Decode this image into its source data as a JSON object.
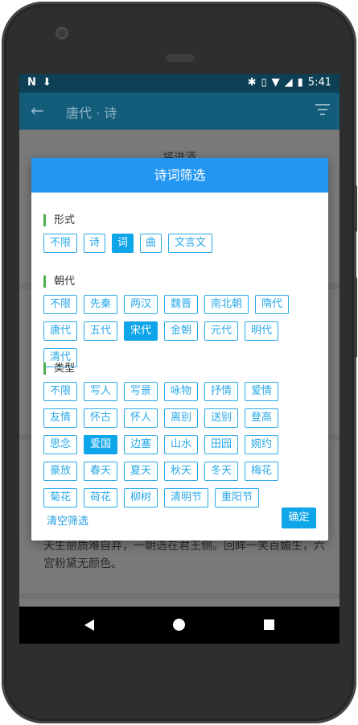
{
  "status": {
    "time": "5:41",
    "left_icons": [
      "N",
      "⬇"
    ],
    "right_icons": [
      "bluetooth-icon",
      "vibrate-icon",
      "wifi-icon",
      "signal-icon",
      "battery-icon"
    ]
  },
  "appbar": {
    "title": "唐代 · 诗"
  },
  "background": {
    "poem_title": "将进酒",
    "poem_excerpt": "天生丽质难自弃，一朝选在君王侧。回眸一笑百媚生，六宫粉黛无颜色。"
  },
  "dialog": {
    "title": "诗词筛选",
    "sections": [
      {
        "title": "形式",
        "options": [
          "不限",
          "诗",
          "词",
          "曲",
          "文言文"
        ],
        "selected": "词"
      },
      {
        "title": "朝代",
        "options": [
          "不限",
          "先秦",
          "两汉",
          "魏晋",
          "南北朝",
          "隋代",
          "唐代",
          "五代",
          "宋代",
          "金朝",
          "元代",
          "明代",
          "清代"
        ],
        "selected": "宋代"
      },
      {
        "title": "类型",
        "options": [
          "不限",
          "写人",
          "写景",
          "咏物",
          "抒情",
          "爱情",
          "友情",
          "怀古",
          "怀人",
          "离别",
          "送别",
          "登高",
          "思念",
          "爱国",
          "边塞",
          "山水",
          "田园",
          "婉约",
          "豪放",
          "春天",
          "夏天",
          "秋天",
          "冬天",
          "梅花",
          "菊花",
          "荷花",
          "柳树",
          "清明节",
          "重阳节"
        ],
        "selected": "爱国"
      }
    ],
    "clear_label": "清空筛选",
    "confirm_label": "确定"
  },
  "colors": {
    "dialog_header": "#2196f3",
    "chip": "#29a9e8",
    "chip_selected": "#0ea5e9",
    "section_marker": "#4caf50"
  }
}
